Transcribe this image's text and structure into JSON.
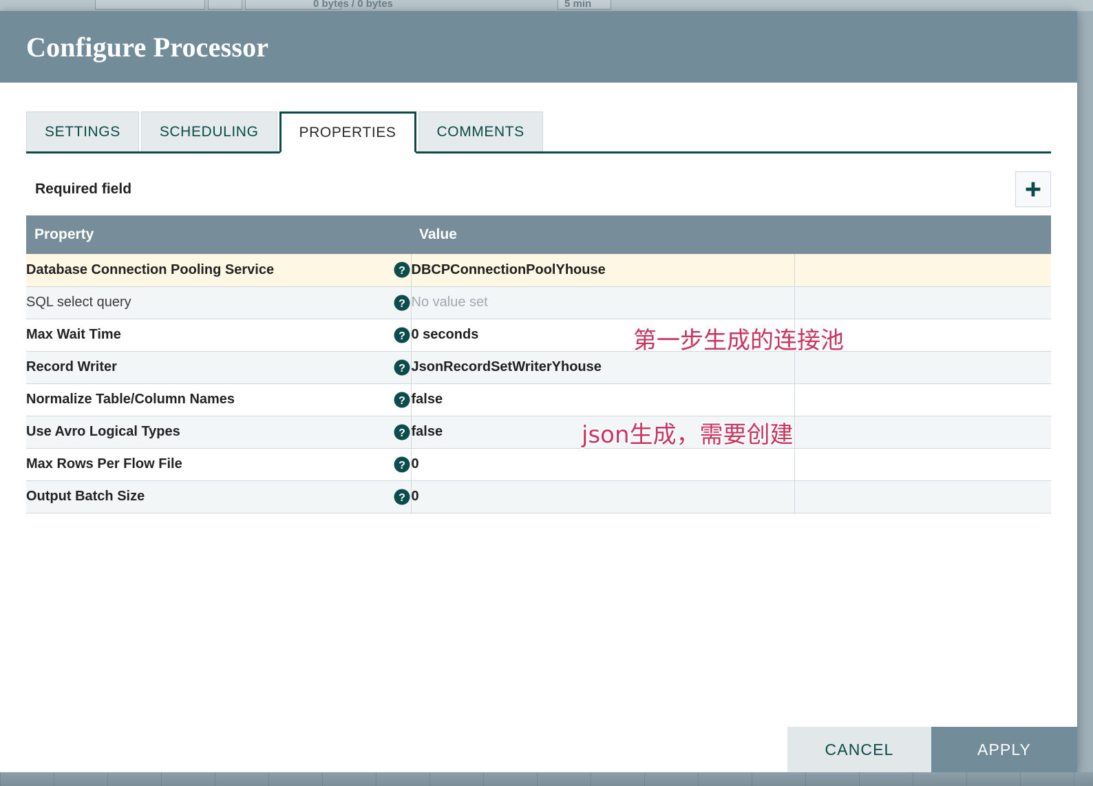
{
  "backdrop": {
    "bytes_text": "0 bytes / 0 bytes",
    "duration_text": "5 min"
  },
  "dialog": {
    "title": "Configure Processor"
  },
  "tabs": [
    {
      "label": "SETTINGS",
      "active": false
    },
    {
      "label": "SCHEDULING",
      "active": false
    },
    {
      "label": "PROPERTIES",
      "active": true
    },
    {
      "label": "COMMENTS",
      "active": false
    }
  ],
  "toolbar": {
    "required_field_label": "Required field",
    "add_button_icon": "plus-icon"
  },
  "table": {
    "columns": [
      "Property",
      "Value"
    ],
    "help_icon": "help-circle-icon",
    "rows": [
      {
        "property": "Database Connection Pooling Service",
        "value": "DBCPConnectionPoolYhouse",
        "required": true,
        "selected": true,
        "unset": false
      },
      {
        "property": "SQL select query",
        "value": "No value set",
        "required": false,
        "selected": false,
        "unset": true
      },
      {
        "property": "Max Wait Time",
        "value": "0 seconds",
        "required": true,
        "selected": false,
        "unset": false
      },
      {
        "property": "Record Writer",
        "value": "JsonRecordSetWriterYhouse",
        "required": true,
        "selected": false,
        "unset": false
      },
      {
        "property": "Normalize Table/Column Names",
        "value": "false",
        "required": true,
        "selected": false,
        "unset": false
      },
      {
        "property": "Use Avro Logical Types",
        "value": "false",
        "required": true,
        "selected": false,
        "unset": false
      },
      {
        "property": "Max Rows Per Flow File",
        "value": "0",
        "required": true,
        "selected": false,
        "unset": false
      },
      {
        "property": "Output Batch Size",
        "value": "0",
        "required": true,
        "selected": false,
        "unset": false
      }
    ]
  },
  "annotations": [
    {
      "text": "第一步生成的连接池",
      "color": "#c8365f"
    },
    {
      "text": "json生成，需要创建",
      "color": "#c8365f"
    }
  ],
  "footer": {
    "cancel_label": "CANCEL",
    "apply_label": "APPLY"
  },
  "colors": {
    "header_bg": "#728c99",
    "table_header_bg": "#778d99",
    "selected_row_bg": "#fdf7e3",
    "accent_teal": "#0b4a46",
    "annotation": "#c8365f"
  }
}
